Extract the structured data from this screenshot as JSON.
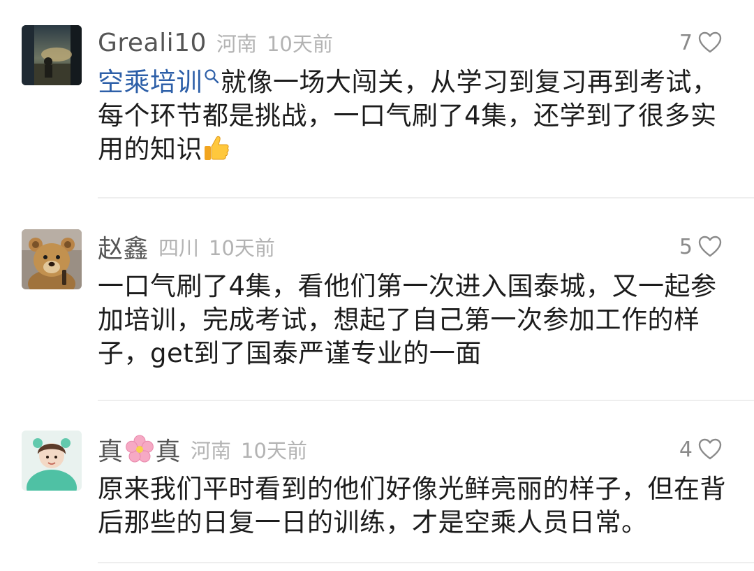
{
  "comments": [
    {
      "username": "Greali10",
      "location": "河南",
      "time": "10天前",
      "likes": "7",
      "topic": "空乘培训",
      "text": "就像一场大闯关，从学习到复习再到考试，每个环节都是挑战，一口气刷了4集，还学到了很多实用的知识",
      "emoji": "thumbs-up"
    },
    {
      "username": "赵鑫",
      "location": "四川",
      "time": "10天前",
      "likes": "5",
      "text": "一口气刷了4集，看他们第一次进入国泰城，又一起参加培训，完成考试，想起了自己第一次参加工作的样子，get到了国泰严谨专业的一面"
    },
    {
      "username_part1": "真",
      "username_emoji": "cherry-blossom",
      "username_part2": "真",
      "location": "河南",
      "time": "10天前",
      "likes": "4",
      "text": "原来我们平时看到的他们好像光鲜亮丽的样子，但在背后那些的日复一日的训练，才是空乘人员日常。"
    }
  ],
  "icons": {
    "like": "heart-outline-icon",
    "topic_search": "search-icon"
  },
  "colors": {
    "topic_link": "#2d5fa8",
    "username": "#555555",
    "meta": "#b3b3b3",
    "divider": "#eeeeee"
  }
}
